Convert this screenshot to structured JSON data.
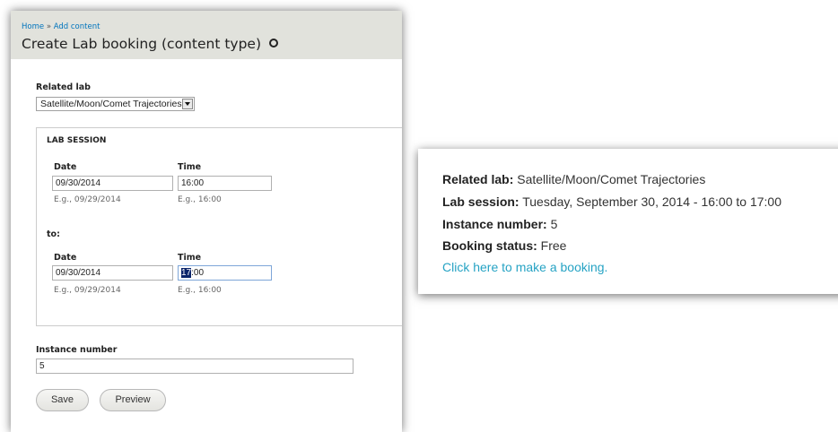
{
  "breadcrumb": {
    "home": "Home",
    "separator": "»",
    "current": "Add content"
  },
  "page_title": "Create Lab booking (content type)",
  "related_lab": {
    "label": "Related lab",
    "selected": "Satellite/Moon/Comet Trajectories"
  },
  "lab_session": {
    "legend": "LAB SESSION",
    "from": {
      "date_label": "Date",
      "date_value": "09/30/2014",
      "date_hint": "E.g., 09/29/2014",
      "time_label": "Time",
      "time_value": "16:00",
      "time_hint": "E.g., 16:00"
    },
    "to_label": "to:",
    "to": {
      "date_label": "Date",
      "date_value": "09/30/2014",
      "date_hint": "E.g., 09/29/2014",
      "time_label": "Time",
      "time_selected": "17",
      "time_rest": ":00",
      "time_hint": "E.g., 16:00"
    }
  },
  "instance_number": {
    "label": "Instance number",
    "value": "5"
  },
  "buttons": {
    "save": "Save",
    "preview": "Preview"
  },
  "result": {
    "related_lab_label": "Related lab:",
    "related_lab_value": "Satellite/Moon/Comet Trajectories",
    "session_label": "Lab session:",
    "session_value": "Tuesday, September 30, 2014 - 16:00 to 17:00",
    "instance_label": "Instance number:",
    "instance_value": "5",
    "status_label": "Booking status:",
    "status_value": "Free",
    "booking_link": "Click here to make a booking."
  },
  "colors": {
    "link": "#0074bd",
    "result_link": "#26a3c4",
    "header_bg": "#e1e2dc"
  }
}
